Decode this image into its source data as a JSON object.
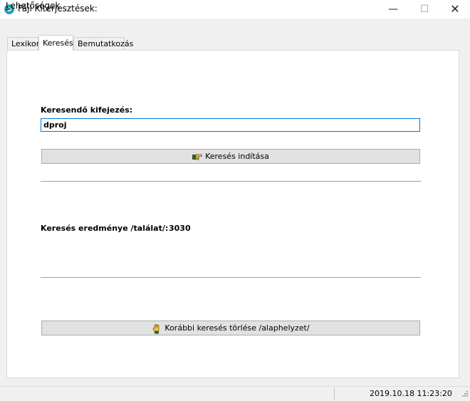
{
  "window": {
    "title": "Fájl Kiterjesztések:",
    "controls": {
      "minimize": "—",
      "maximize": "☐",
      "close": "✕"
    }
  },
  "menu": {
    "options_first": "L",
    "options_rest": "ehetőségek"
  },
  "tabs": [
    {
      "label": "Lexikon",
      "active": false
    },
    {
      "label": "Keresés",
      "active": true
    },
    {
      "label": "Bemutatkozás",
      "active": false
    }
  ],
  "search": {
    "label": "Keresendő kifejezés:",
    "value": "dproj",
    "start_button_label": "Keresés indítása",
    "start_button_icon": "pointing-hand-icon"
  },
  "result": {
    "label": "Keresés eredménye /találat/:",
    "count": "3030"
  },
  "clear": {
    "button_label": "Korábbi keresés törlése /alaphelyzet/",
    "button_icon": "raised-hand-icon"
  },
  "status": {
    "datetime": "2019.10.18 11:23:20"
  },
  "colors": {
    "accent": "#0078d7",
    "app_icon": "#23a3b5",
    "window_bg": "#f0f0f0",
    "button_bg": "#e1e1e1"
  }
}
